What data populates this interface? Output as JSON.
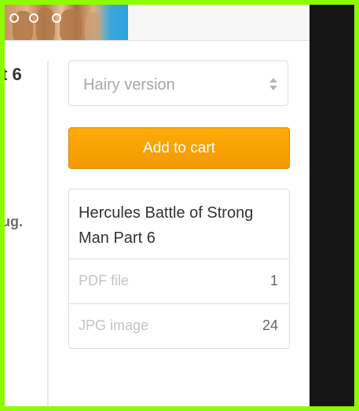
{
  "product": {
    "title_fragment": "t 6",
    "side_fragment": "ug."
  },
  "variant_select": {
    "selected": "Hairy version"
  },
  "cart": {
    "add_label": "Add to cart"
  },
  "file_box": {
    "name": "Hercules Battle of Strong Man Part 6",
    "rows": [
      {
        "label": "PDF file",
        "count": "1"
      },
      {
        "label": "JPG image",
        "count": "24"
      }
    ]
  },
  "colors": {
    "accent": "#f5a000",
    "border_outer": "#8efb00",
    "dark_panel": "#161616"
  },
  "icons": [
    "select-arrows-icon"
  ]
}
